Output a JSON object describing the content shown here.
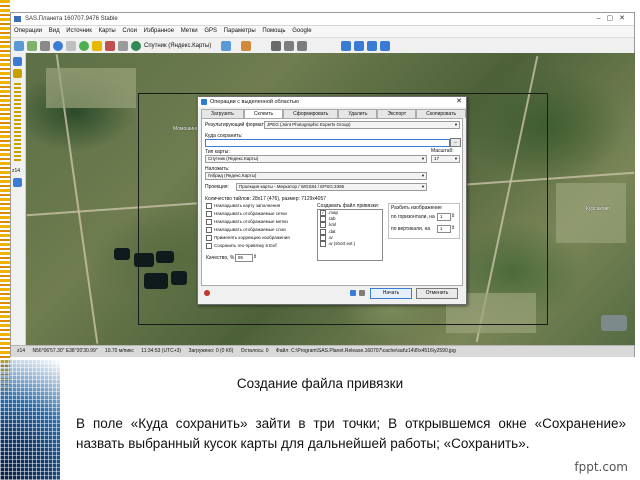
{
  "slide": {
    "caption": "Создание файла привязки",
    "paragraph": "В поле «Куда сохранить» зайти в три точки; В открывшемся окне «Сохранение» назвать выбранный кусок карты для дальнейшей работы; «Сохранить».",
    "brand": "fppt.com"
  },
  "window": {
    "title": "SAS.Планета 160707.9476 Stable",
    "menu": [
      "Операции",
      "Вид",
      "Источник",
      "Карты",
      "Слои",
      "Избранное",
      "Метки",
      "GPS",
      "Параметры",
      "Помощь",
      "Google"
    ],
    "toolbar": {
      "map_button": "Спутник (Яндекс.Карты)"
    },
    "zoom_label": "z14",
    "statusbar": [
      "z14",
      "N56°06'57.30\" E38°20'30.99\"",
      "10.70 м/пикс",
      "11:34:53 (UTC+3)",
      "Загружено: 0 (0 Кб)",
      "Осталось: 0",
      "Файл: C:\\Program\\SAS.Planet.Release.160707\\cache\\sat\\z14\\8\\x4516\\y2590.jpg"
    ],
    "map_labels": [
      "Момошино",
      "Курсаково"
    ]
  },
  "dialog": {
    "title": "Операции с выделенной областью",
    "close": "✕",
    "tabs": [
      "Загрузить",
      "Склеить",
      "Сформировать",
      "Удалить",
      "Экспорт",
      "Скопировать"
    ],
    "active_tab": "Склеить",
    "format_label": "Результирующий формат:",
    "format_value": "JPEG (Joint Photographic Experts Group)",
    "save_label": "Куда сохранить:",
    "save_value": "",
    "save_browse": "...",
    "map_type_label": "Тип карты:",
    "map_type_value": "Спутник (Яндекс.Карты)",
    "scale_label": "Масштаб:",
    "scale_value": "17",
    "overlay_label": "Наложить:",
    "overlay_value": "Гибрид (Яндекс.Карты)",
    "projection_label": "Проекция:",
    "projection_value": "Проекция карты - Меркатор / WGS84 / EPSG:3395",
    "tiles_info": "Количество тайлов: 28x17 (476), размер: 7129x4057",
    "checkboxes": [
      "Накладывать карту заполнения",
      "Накладывать отображаемые сетки",
      "Накладывать отображаемые метки",
      "Накладывать отображаемые слои",
      "Применять коррекцию изображения",
      "Сохранить гео-привязку в Exif"
    ],
    "georef_label": "Создавать файл привязки:",
    "georef_items": [
      ".map",
      ".tab",
      ".kml",
      ".dat",
      ".w",
      ".w (short ext.)"
    ],
    "split_label": "Разбить изображение",
    "split_h_label": "по горизонтали, на",
    "split_h_value": "1",
    "split_v_label": "по вертикали, на",
    "split_v_value": "1",
    "quality_label": "Качество, %",
    "quality_value": "95",
    "start_button": "Начать",
    "cancel_button": "Отменить"
  }
}
